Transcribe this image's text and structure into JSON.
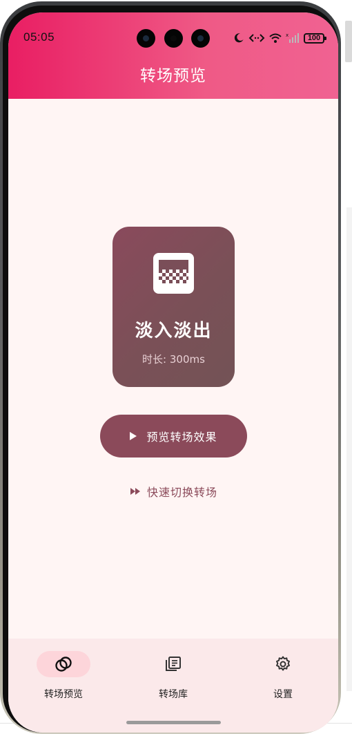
{
  "status_bar": {
    "time": "05:05",
    "battery": "100",
    "icons": [
      "moon-icon",
      "code-bracket-icon",
      "wifi-icon",
      "signal-icon",
      "battery-icon"
    ]
  },
  "header": {
    "title": "转场预览",
    "gradient_from": "#e91e63",
    "gradient_to": "#f06292"
  },
  "transition_card": {
    "icon": "fade-pattern-icon",
    "name": "淡入淡出",
    "duration": "时长: 300ms",
    "background": "#7f4e5a"
  },
  "actions": {
    "preview_label": "预览转场效果",
    "preview_icon": "play-icon",
    "quick_switch_label": "快速切换转场",
    "quick_switch_icon": "fast-forward-icon",
    "accent": "#8b4a5a"
  },
  "bottom_nav": {
    "items": [
      {
        "label": "转场预览",
        "icon": "overlap-circles-icon",
        "active": true
      },
      {
        "label": "转场库",
        "icon": "library-icon",
        "active": false
      },
      {
        "label": "设置",
        "icon": "gear-icon",
        "active": false
      }
    ],
    "active_pill_color": "#fdd5da"
  }
}
